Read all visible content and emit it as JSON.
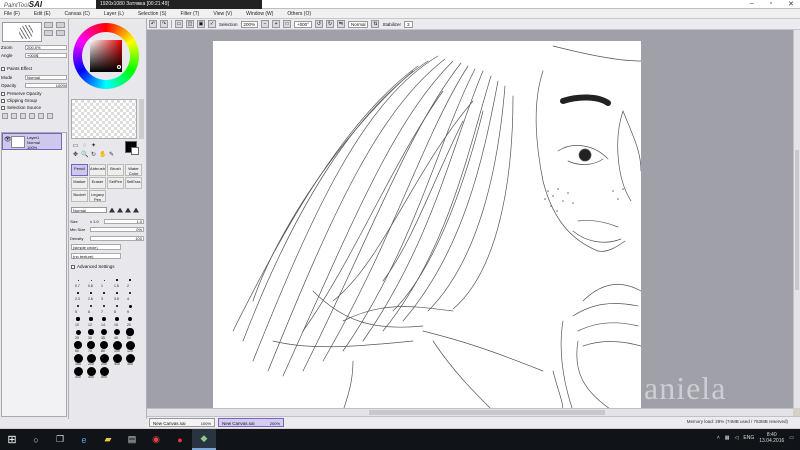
{
  "app": {
    "logo_small": "PaintTool",
    "logo_big": "SAI",
    "title": "1920x1080",
    "subtitle": "Затяжка [00:21:49]"
  },
  "menu": [
    "File (F)",
    "Edit (E)",
    "Canvas (C)",
    "Layer (L)",
    "Selection (S)",
    "Filter (T)",
    "View (V)",
    "Window (W)",
    "Others (O)"
  ],
  "navigator": {
    "zoom_label": "Zoom",
    "zoom_value": "200.0%",
    "angle_label": "Angle",
    "angle_value": "+000$"
  },
  "layer_props": {
    "paint_effect": "Paints Effect",
    "mode_label": "Mode",
    "mode_value": "Normal",
    "opacity_label": "Opacity",
    "opacity_value": "100%",
    "preserve": "Preserve Opacity",
    "clipping": "Clipping Group",
    "selection_source": "Selection Source"
  },
  "layer": {
    "name": "Layer1",
    "mode": "Normal",
    "opacity": "100%"
  },
  "color": {
    "foreground": "#000000",
    "hue": "#e00000"
  },
  "brushes": [
    {
      "name": "Pencil",
      "selected": true
    },
    {
      "name": "Airbrush",
      "selected": false
    },
    {
      "name": "Brush",
      "selected": false
    },
    {
      "name": "Water Color",
      "selected": false
    },
    {
      "name": "Marker",
      "selected": false
    },
    {
      "name": "Eraser",
      "selected": false
    },
    {
      "name": "SelPen",
      "selected": false
    },
    {
      "name": "SelEras",
      "selected": false
    },
    {
      "name": "Bucket",
      "selected": false
    },
    {
      "name": "Legacy Pen",
      "selected": false
    }
  ],
  "brush_settings": {
    "blend_mode": "Normal",
    "size_label": "Size",
    "size_mult": "x 1.0",
    "size_value": "1.0",
    "min_size_label": "Min Size",
    "min_size_value": "0%",
    "density_label": "Density",
    "density_value": "100",
    "shape": "(simple circle)",
    "texture": "(no texture)",
    "advanced": "Advanced Settings"
  },
  "size_presets": [
    "0.7",
    "0.8",
    "1",
    "1.5",
    "2",
    "2.3",
    "2.6",
    "3",
    "3.5",
    "4",
    "5",
    "6",
    "7",
    "8",
    "9",
    "10",
    "12",
    "14",
    "16",
    "20",
    "25",
    "30",
    "35",
    "40",
    "50",
    "60",
    "70",
    "80",
    "100",
    "120",
    "160",
    "200",
    "250",
    "300",
    "350",
    "400",
    "450",
    "500"
  ],
  "toolbar": {
    "selection_label": "Selection",
    "zoom": "200%",
    "angle": "+000°",
    "mode": "Normal",
    "stabilizer_label": "Stabilizer",
    "stabilizer_value": "3"
  },
  "doc_tabs": [
    {
      "name": "New Canvas.sai",
      "zoom": "100%",
      "active": false
    },
    {
      "name": "New Canvas.sai",
      "zoom": "200%",
      "active": true
    }
  ],
  "status": {
    "memory": "Memory load: 28% (74MB used / 763MB reserved)"
  },
  "watermark": "aniela",
  "taskbar": {
    "lang": "ENG",
    "time": "8:40",
    "date": "13.04.2016"
  }
}
